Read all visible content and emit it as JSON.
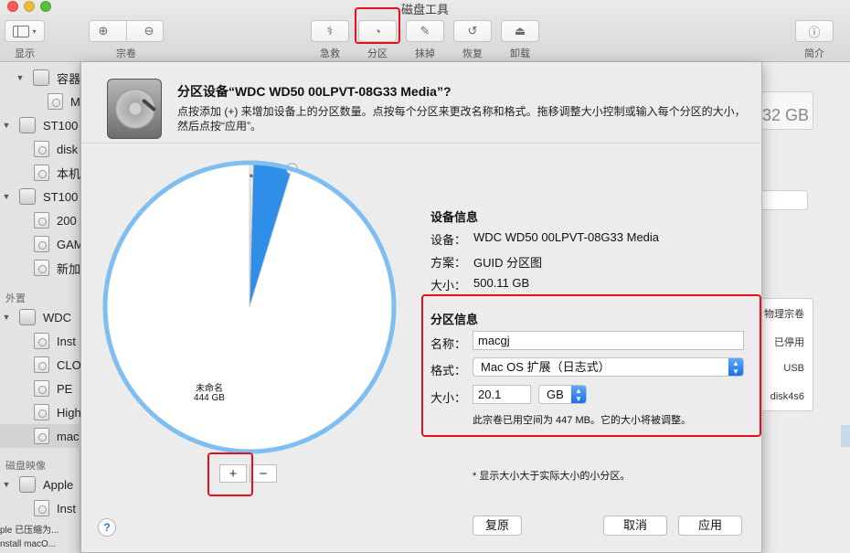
{
  "window": {
    "title": "磁盘工具",
    "toolbar": {
      "display_label": "显示",
      "volume_label": "宗卷",
      "first_aid_label": "急救",
      "partition_label": "分区",
      "erase_label": "抹掉",
      "restore_label": "恢复",
      "unmount_label": "卸载",
      "info_label": "简介"
    }
  },
  "sidebar": {
    "internal_items": [
      "容器",
      "M",
      "ST100",
      "disk",
      "本机",
      "ST100",
      "200",
      "GAM",
      "新加"
    ],
    "external_header": "外置",
    "external_items": [
      "WDC",
      "Inst",
      "CLO",
      "PE",
      "High",
      "mac"
    ],
    "images_header": "磁盘映像",
    "image_items": [
      "Apple",
      "Inst"
    ],
    "bottom_status_1": "ple 已压缩为...",
    "bottom_status_2": "nstall macO..."
  },
  "background": {
    "capacity": "32 GB",
    "props": [
      "物理宗卷",
      "已停用",
      "USB",
      "disk4s6"
    ]
  },
  "sheet": {
    "title": "分区设备“WDC WD50 00LPVT-08G33 Media”?",
    "description": "点按添加 (+) 来增加设备上的分区数量。点按每个分区来更改名称和格式。拖移调整大小控制或输入每个分区的大小，然后点按“应用”。",
    "pie": {
      "unnamed_name": "未命名",
      "unnamed_size": "444 GB",
      "star1": "*",
      "star2": "*"
    },
    "add_label": "+",
    "remove_label": "−",
    "device_info": {
      "header": "设备信息",
      "device_key": "设备：",
      "device_val": "WDC WD50 00LPVT-08G33 Media",
      "scheme_key": "方案：",
      "scheme_val": "GUID 分区图",
      "size_key": "大小：",
      "size_val": "500.11 GB"
    },
    "partition_info": {
      "header": "分区信息",
      "name_key": "名称：",
      "name_value": "macgj",
      "format_key": "格式：",
      "format_value": "Mac OS 扩展（日志式）",
      "size_key": "大小：",
      "size_value": "20.1",
      "unit_value": "GB",
      "note": "此宗卷已用空间为 447 MB。它的大小将被调整。"
    },
    "footnote": "* 显示大小大于实际大小的小分区。",
    "help_label": "?",
    "revert_label": "复原",
    "cancel_label": "取消",
    "apply_label": "应用"
  },
  "chart_data": {
    "type": "pie",
    "slices": [
      {
        "name": "未命名",
        "value": 444
      },
      {
        "name": "macgj",
        "value": 20.1
      },
      {
        "name": "*",
        "value": 1
      },
      {
        "name": "*",
        "value": 1
      }
    ]
  },
  "colors": {
    "accent": "#2f8fe8",
    "pie_ring": "#7fbef0",
    "highlight": "#e4101c"
  }
}
